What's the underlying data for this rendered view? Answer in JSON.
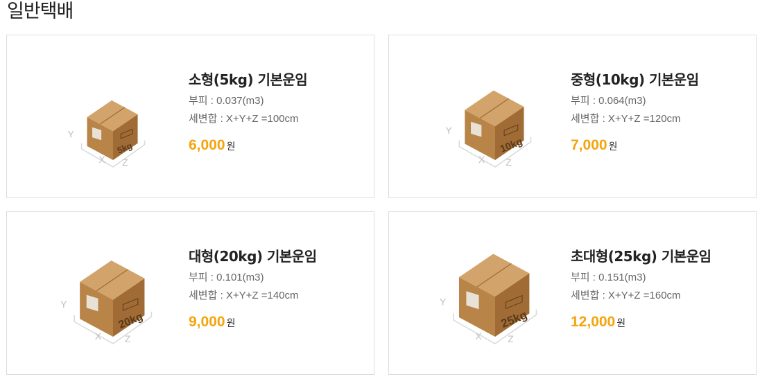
{
  "page": {
    "title": "일반택배"
  },
  "cards": [
    {
      "title": "소형(5kg) 기본운임",
      "volume": "부피 : 0.037(m3)",
      "dims": "세변합 : X+Y+Z =100cm",
      "price": "6,000",
      "currency": "원",
      "box_label": "5kg",
      "box_scale": 0.72
    },
    {
      "title": "중형(10kg) 기본운임",
      "volume": "부피 : 0.064(m3)",
      "dims": "세변합 : X+Y+Z =120cm",
      "price": "7,000",
      "currency": "원",
      "box_label": "10kg",
      "box_scale": 0.84
    },
    {
      "title": "대형(20kg) 기본운임",
      "volume": "부피 : 0.101(m3)",
      "dims": "세변합 : X+Y+Z =140cm",
      "price": "9,000",
      "currency": "원",
      "box_label": "20kg",
      "box_scale": 0.92
    },
    {
      "title": "초대형(25kg) 기본운임",
      "volume": "부피 : 0.151(m3)",
      "dims": "세변합 : X+Y+Z =160cm",
      "price": "12,000",
      "currency": "원",
      "box_label": "25kg",
      "box_scale": 1.0
    }
  ],
  "axes": {
    "x": "X",
    "y": "Y",
    "z": "Z"
  },
  "colors": {
    "accent": "#f5a40b",
    "box_top": "#d2a36a",
    "box_left": "#b88448",
    "box_right": "#a06b35",
    "box_text": "#5a3a1a"
  }
}
